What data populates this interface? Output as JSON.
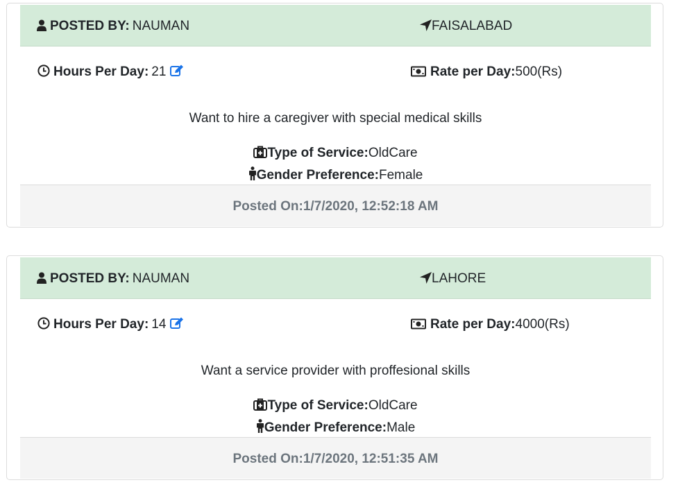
{
  "colors": {
    "header_bg": "#d4ebd9",
    "footer_bg": "#f4f4f4",
    "edit_icon": "#1a73e8",
    "muted_text": "#6c757d"
  },
  "icons": [
    "user-icon",
    "location-arrow-icon",
    "clock-icon",
    "edit-icon",
    "money-icon",
    "medkit-icon",
    "male-icon"
  ],
  "posts": [
    {
      "posted_by_label": "POSTED BY:",
      "posted_by": "NAUMAN",
      "location": "FAISALABAD",
      "hours_label": "Hours Per Day:",
      "hours": "21",
      "rate_label": "Rate per Day:",
      "rate": "500(Rs)",
      "description": "Want to hire a caregiver with special medical skills",
      "service_label": "Type of Service:",
      "service": "OldCare",
      "gender_label": "Gender Preference:",
      "gender": "Female",
      "posted_on_label": "Posted On:",
      "posted_on": "1/7/2020, 12:52:18 AM"
    },
    {
      "posted_by_label": "POSTED BY:",
      "posted_by": "NAUMAN",
      "location": "LAHORE",
      "hours_label": "Hours Per Day:",
      "hours": "14",
      "rate_label": "Rate per Day:",
      "rate": "4000(Rs)",
      "description": "Want a service provider with proffesional skills",
      "service_label": "Type of Service:",
      "service": "OldCare",
      "gender_label": "Gender Preference:",
      "gender": "Male",
      "posted_on_label": "Posted On:",
      "posted_on": "1/7/2020, 12:51:35 AM"
    }
  ]
}
